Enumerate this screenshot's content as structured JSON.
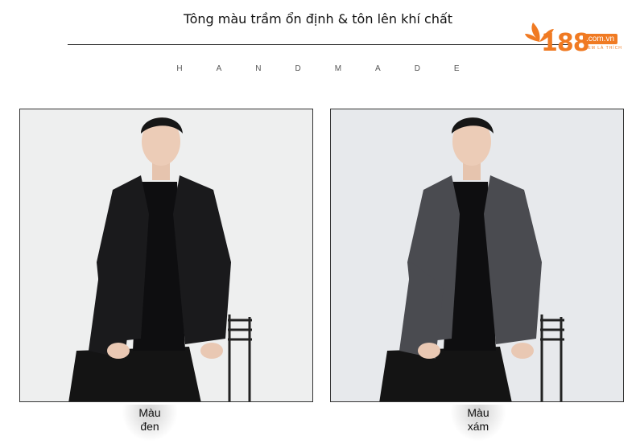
{
  "header": {
    "title": "Tông màu trầm ổn định & tôn lên khí chất",
    "subtitle": "HANDMADE"
  },
  "logo": {
    "digits": "188",
    "domain": ".com.vn",
    "tagline": "XEM LÀ THÍCH"
  },
  "products": [
    {
      "caption_line1": "Màu",
      "caption_line2": "đen",
      "coat_color": "#1a1a1c"
    },
    {
      "caption_line1": "Màu",
      "caption_line2": "xám",
      "coat_color": "#4a4b50"
    }
  ],
  "colors": {
    "brand": "#f07a22",
    "background": "#ffffff"
  }
}
